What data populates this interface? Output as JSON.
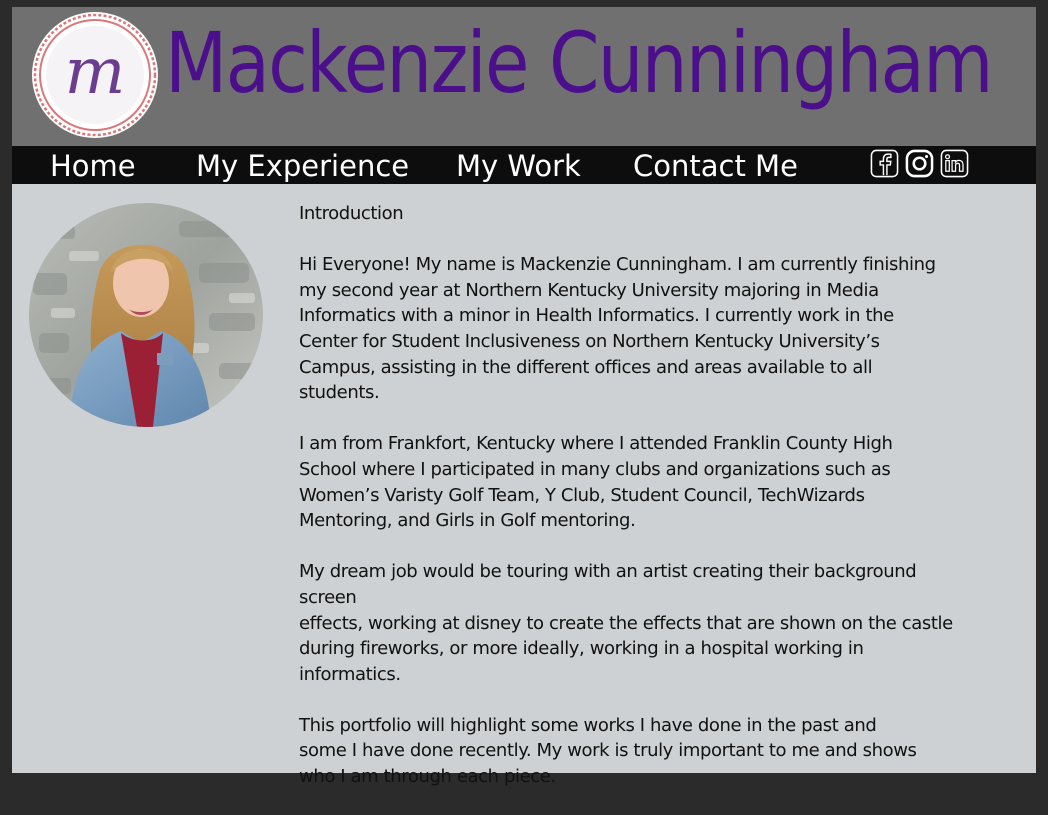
{
  "header": {
    "logo_letter": "m",
    "title": "Mackenzie Cunningham"
  },
  "nav": {
    "items": [
      {
        "label": "Home"
      },
      {
        "label": "My Experience"
      },
      {
        "label": "My Work"
      },
      {
        "label": "Contact Me"
      }
    ],
    "social_icons": [
      "facebook-icon",
      "instagram-icon",
      "linkedin-icon"
    ]
  },
  "main": {
    "heading": "Introduction",
    "paragraphs": [
      "Hi Everyone! My name is Mackenzie Cunningham. I am currently finishing\nmy second year at Northern Kentucky University majoring in Media\nInformatics with a minor in Health Informatics. I currently work in the\nCenter for Student Inclusiveness on Northern Kentucky University’s\nCampus, assisting in the different offices and areas available to all\nstudents.",
      "I am from Frankfort, Kentucky where I attended Franklin County High\nSchool where I participated in many clubs and organizations such as\nWomen’s Varisty Golf Team, Y Club, Student Council, TechWizards\nMentoring,  and Girls in Golf mentoring.",
      "My dream job would be touring with an artist creating their background screen\neffects, working at disney to create the effects that are shown on the castle\nduring fireworks, or more ideally, working in a hospital working in informatics.",
      "This portfolio will highlight some works I have done in the past and\nsome I have done recently. My work is truly important to me and shows\nwho I am through each piece."
    ]
  },
  "colors": {
    "header_bg": "#707070",
    "title": "#4b0f8c",
    "nav_bg": "#0d0d0d",
    "content_bg": "#cdd1d3",
    "logo_ring": "#d9787a"
  }
}
